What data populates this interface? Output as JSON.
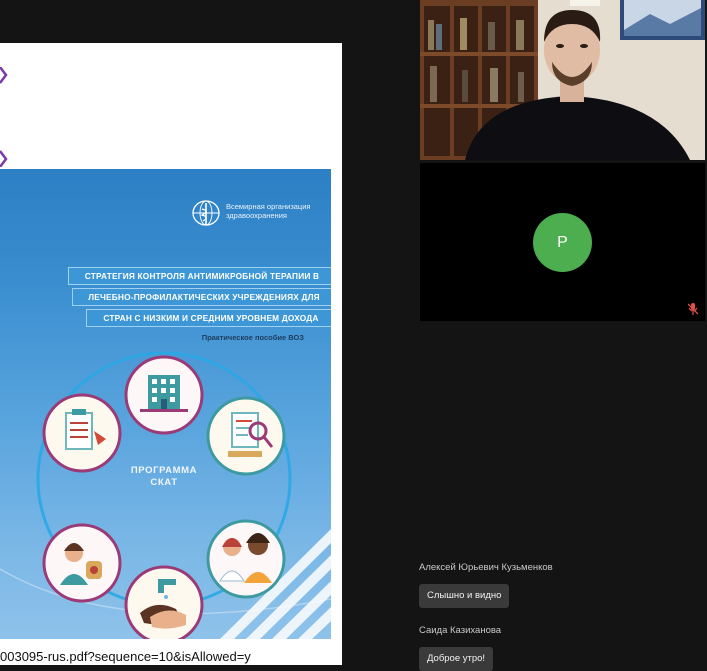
{
  "shared_screen": {
    "cover": {
      "org_name": "Всемирная организация здравоохранения",
      "title_lines": [
        "Стратегия контроля антимикробной терапии в",
        "лечебно-профилактических учреждениях для",
        "стран с низким и средним уровнем дохода"
      ],
      "subtitle": "Практическое пособие ВОЗ",
      "program_label": "ПРОГРАММА СКАТ",
      "cycle_icons": [
        "hospital-icon",
        "lab-analysis-icon",
        "doctors-group-icon",
        "handwashing-icon",
        "pharmacy-icon",
        "checklist-icon"
      ]
    },
    "url_text": "003095-rus.pdf?sequence=10&isAllowed=y"
  },
  "participants": [
    {
      "type": "video"
    },
    {
      "type": "avatar",
      "initial": "P",
      "avatar_color": "#4cae4f",
      "muted": true
    }
  ],
  "chat": {
    "messages": [
      {
        "sender": "Алексей Юрьевич Кузьменков",
        "text": "Слышно и видно"
      },
      {
        "sender": "Саида Казиханова",
        "text": "Доброе утро!"
      }
    ]
  },
  "colors": {
    "background": "#141414",
    "cover_blue": "#3b8fd0",
    "ring_line": "#2aa7e6",
    "bubble": "#3a3a3a"
  }
}
